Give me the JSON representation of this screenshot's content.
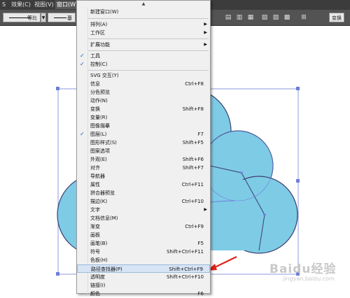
{
  "menubar": {
    "items": [
      {
        "label": "S"
      },
      {
        "label": "效果(C)"
      },
      {
        "label": "视图(V)"
      },
      {
        "label": "窗口(W)"
      }
    ]
  },
  "toolbar": {
    "stroke1_label": "等比",
    "stroke2_label": "基",
    "right_button": "变换"
  },
  "menu": {
    "items": [
      {
        "label": "新建窗口(W)",
        "shortcut": "",
        "submenu": false,
        "checked": false
      },
      {
        "label": "排列(A)",
        "shortcut": "",
        "submenu": true,
        "checked": false
      },
      {
        "label": "工作区",
        "shortcut": "",
        "submenu": true,
        "checked": false
      },
      {
        "label": "扩展功能",
        "shortcut": "",
        "submenu": true,
        "checked": false
      },
      {
        "label": "工具",
        "shortcut": "",
        "submenu": false,
        "checked": true
      },
      {
        "label": "控制(C)",
        "shortcut": "",
        "submenu": false,
        "checked": true
      },
      {
        "label": "SVG 交互(Y)",
        "shortcut": "",
        "submenu": false,
        "checked": false
      },
      {
        "label": "信息",
        "shortcut": "Ctrl+F8",
        "submenu": false,
        "checked": false
      },
      {
        "label": "分色预览",
        "shortcut": "",
        "submenu": false,
        "checked": false
      },
      {
        "label": "动作(N)",
        "shortcut": "",
        "submenu": false,
        "checked": false
      },
      {
        "label": "变换",
        "shortcut": "Shift+F8",
        "submenu": false,
        "checked": false
      },
      {
        "label": "变量(R)",
        "shortcut": "",
        "submenu": false,
        "checked": false
      },
      {
        "label": "图像描摹",
        "shortcut": "",
        "submenu": false,
        "checked": false
      },
      {
        "label": "图层(L)",
        "shortcut": "F7",
        "submenu": false,
        "checked": true
      },
      {
        "label": "图形样式(S)",
        "shortcut": "Shift+F5",
        "submenu": false,
        "checked": false
      },
      {
        "label": "图案选项",
        "shortcut": "",
        "submenu": false,
        "checked": false
      },
      {
        "label": "外观(E)",
        "shortcut": "Shift+F6",
        "submenu": false,
        "checked": false
      },
      {
        "label": "对齐",
        "shortcut": "Shift+F7",
        "submenu": false,
        "checked": false
      },
      {
        "label": "导航器",
        "shortcut": "",
        "submenu": false,
        "checked": false
      },
      {
        "label": "属性",
        "shortcut": "Ctrl+F11",
        "submenu": false,
        "checked": false
      },
      {
        "label": "拼合器预览",
        "shortcut": "",
        "submenu": false,
        "checked": false
      },
      {
        "label": "描边(K)",
        "shortcut": "Ctrl+F10",
        "submenu": false,
        "checked": false
      },
      {
        "label": "文字",
        "shortcut": "",
        "submenu": true,
        "checked": false
      },
      {
        "label": "文档信息(M)",
        "shortcut": "",
        "submenu": false,
        "checked": false
      },
      {
        "label": "渐变",
        "shortcut": "Ctrl+F9",
        "submenu": false,
        "checked": false
      },
      {
        "label": "画板",
        "shortcut": "",
        "submenu": false,
        "checked": false
      },
      {
        "label": "画笔(B)",
        "shortcut": "F5",
        "submenu": false,
        "checked": false
      },
      {
        "label": "符号",
        "shortcut": "Shift+Ctrl+F11",
        "submenu": false,
        "checked": false
      },
      {
        "label": "色板(H)",
        "shortcut": "",
        "submenu": false,
        "checked": false
      },
      {
        "label": "路径查找器(P)",
        "shortcut": "Shift+Ctrl+F9",
        "submenu": false,
        "checked": false,
        "highlighted": true
      },
      {
        "label": "透明度",
        "shortcut": "Shift+Ctrl+F10",
        "submenu": false,
        "checked": false
      },
      {
        "label": "链接(I)",
        "shortcut": "",
        "submenu": false,
        "checked": false
      },
      {
        "label": "颜色",
        "shortcut": "F6",
        "submenu": false,
        "checked": false
      }
    ]
  },
  "colors": {
    "cloud_fill": "#7ecbe6",
    "cloud_stroke": "#3a3f6e",
    "selection": "#6e7fd6",
    "arrow": "#e0231b"
  },
  "watermark": {
    "text": "Baidu经验",
    "sub": "jingyan.baidu.com"
  }
}
